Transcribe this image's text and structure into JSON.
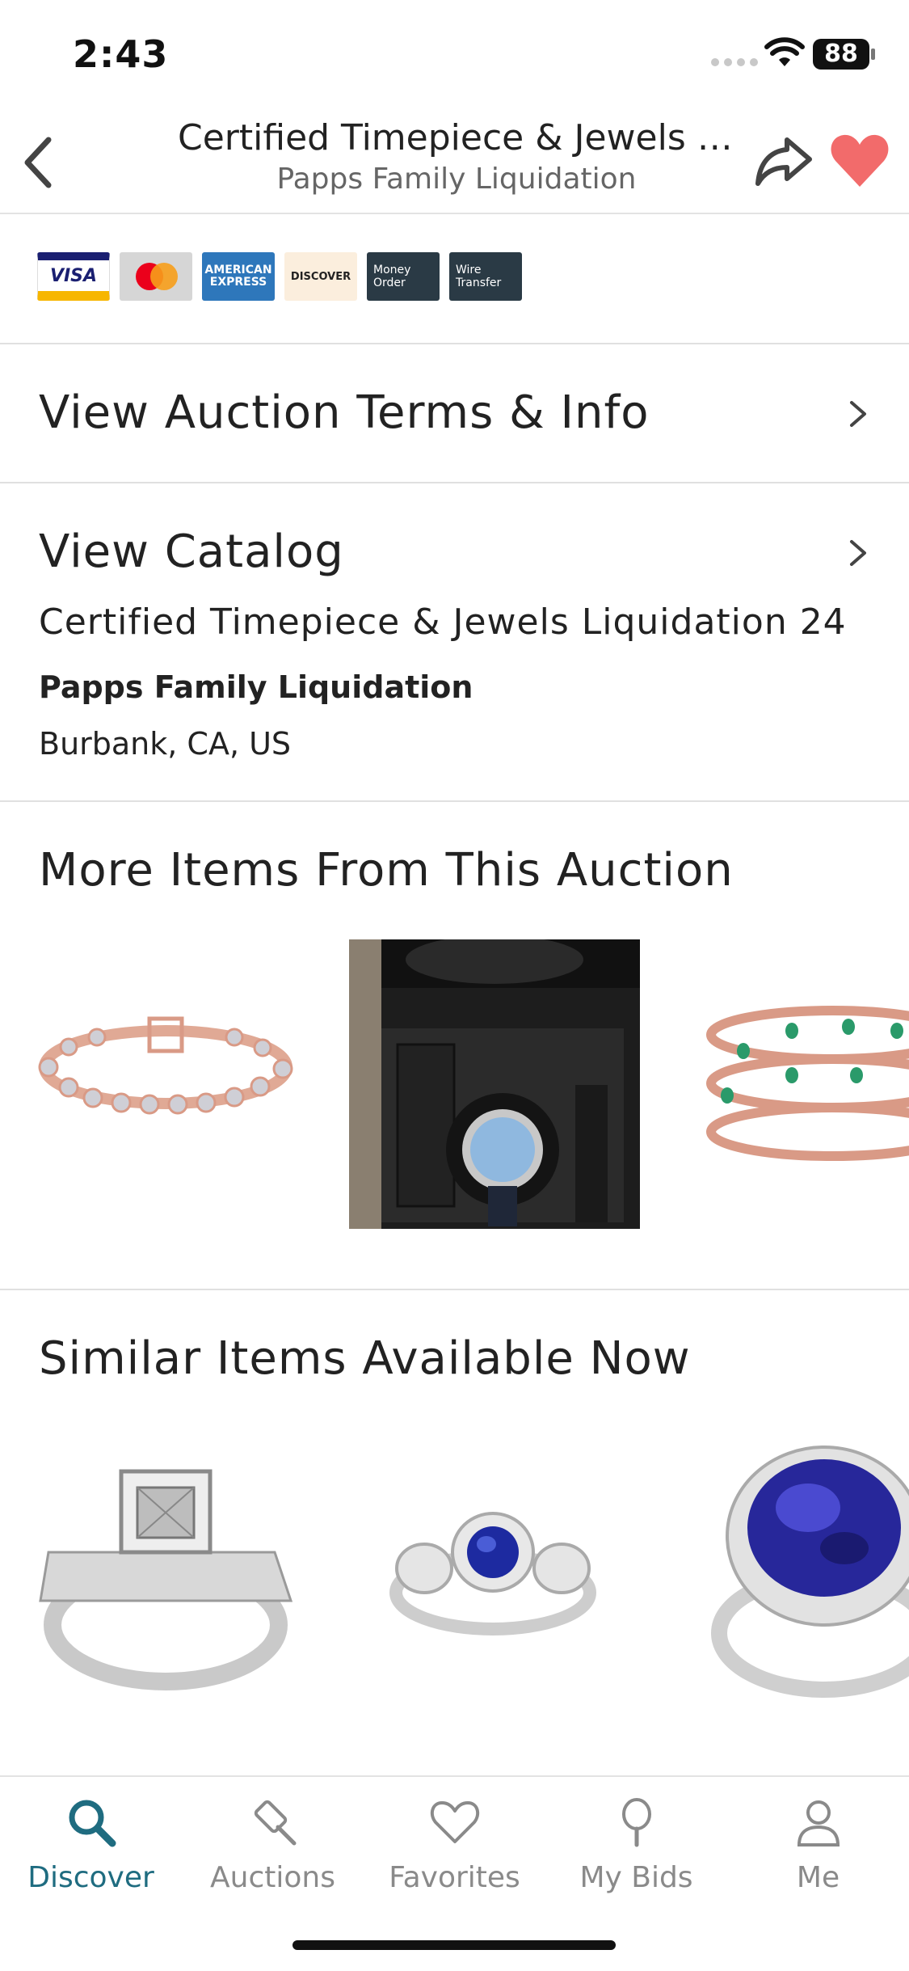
{
  "status": {
    "time": "2:43",
    "battery": "88"
  },
  "header": {
    "title": "Certified Timepiece & Jewels Liq...",
    "subtitle": "Papps Family Liquidation"
  },
  "payment": {
    "methods": [
      "VISA",
      "MasterCard",
      "AMERICAN EXPRESS",
      "DISCOVER",
      "Money Order",
      "Wire Transfer"
    ]
  },
  "rows": {
    "terms": "View Auction Terms & Info",
    "catalog": "View Catalog"
  },
  "catalog": {
    "name": "Certified Timepiece & Jewels Liquidation 24",
    "house": "Papps Family Liquidation",
    "location": "Burbank, CA, US"
  },
  "sections": {
    "more_items": "More Items From This Auction",
    "similar": "Similar Items Available Now"
  },
  "tabs": [
    {
      "label": "Discover",
      "icon": "search-icon",
      "active": true
    },
    {
      "label": "Auctions",
      "icon": "gavel-icon",
      "active": false
    },
    {
      "label": "Favorites",
      "icon": "heart-icon",
      "active": false
    },
    {
      "label": "My Bids",
      "icon": "paddle-icon",
      "active": false
    },
    {
      "label": "Me",
      "icon": "person-icon",
      "active": false
    }
  ],
  "colors": {
    "accent": "#1f6c80",
    "favorite": "#f26b6b"
  }
}
